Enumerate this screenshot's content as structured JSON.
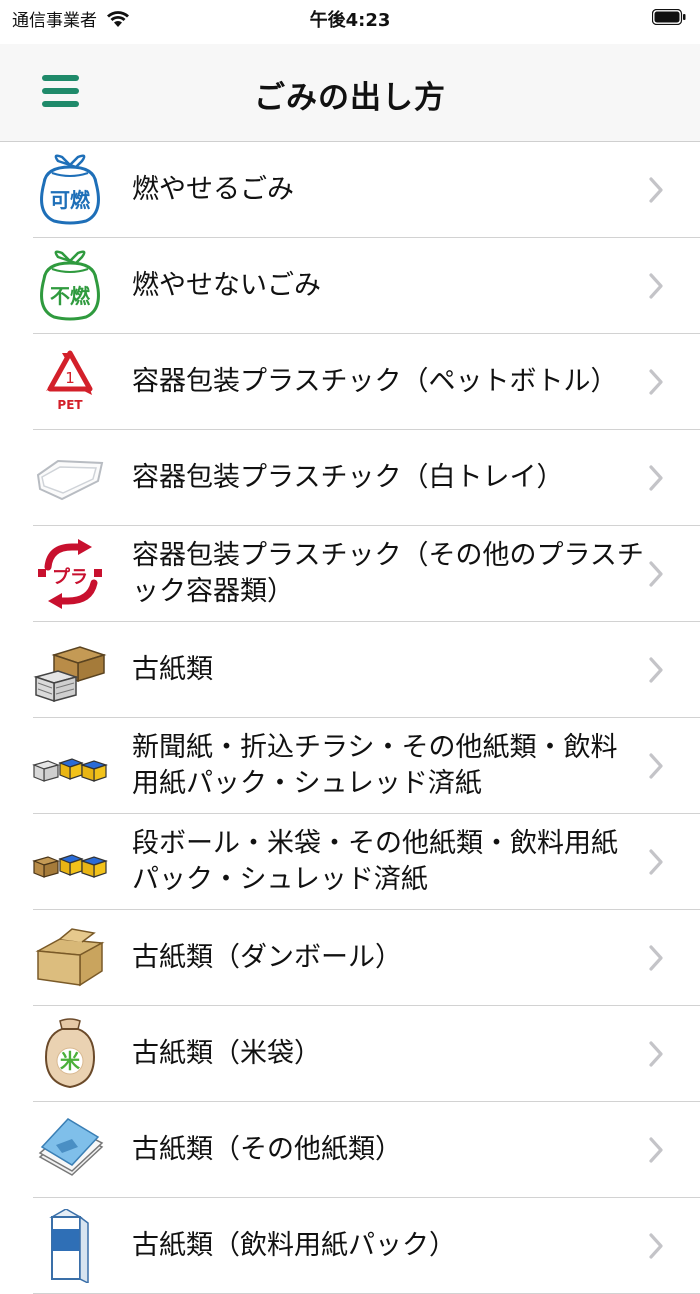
{
  "status_bar": {
    "carrier": "通信事業者",
    "time": "午後4:23"
  },
  "nav": {
    "title": "ごみの出し方",
    "menu_icon": "hamburger-menu-icon",
    "accent_color": "#1f8a6a"
  },
  "list": {
    "items": [
      {
        "label": "燃やせるごみ",
        "icon": "burnable-bag-icon",
        "icon_text": "可燃"
      },
      {
        "label": "燃やせないごみ",
        "icon": "nonburnable-bag-icon",
        "icon_text": "不燃"
      },
      {
        "label": "容器包装プラスチック（ペットボトル）",
        "icon": "pet-recycle-icon",
        "icon_text": "1",
        "icon_sub": "PET"
      },
      {
        "label": "容器包装プラスチック（白トレイ）",
        "icon": "white-tray-icon"
      },
      {
        "label": "容器包装プラスチック（その他のプラスチック容器類）",
        "icon": "plastic-mark-icon",
        "icon_text": "プラ"
      },
      {
        "label": "古紙類",
        "icon": "paper-bundles-icon"
      },
      {
        "label": "新聞紙・折込チラシ・その他紙類・飲料用紙パック・シュレッド済紙",
        "icon": "newspaper-bundles-icon"
      },
      {
        "label": "段ボール・米袋・その他紙類・飲料用紙パック・シュレッド済紙",
        "icon": "cardboard-bundles-icon"
      },
      {
        "label": "古紙類（ダンボール）",
        "icon": "cardboard-box-icon"
      },
      {
        "label": "古紙類（米袋）",
        "icon": "rice-bag-icon",
        "icon_text": "米"
      },
      {
        "label": "古紙類（その他紙類）",
        "icon": "paper-stack-icon"
      },
      {
        "label": "古紙類（飲料用紙パック）",
        "icon": "milk-carton-icon"
      }
    ]
  }
}
